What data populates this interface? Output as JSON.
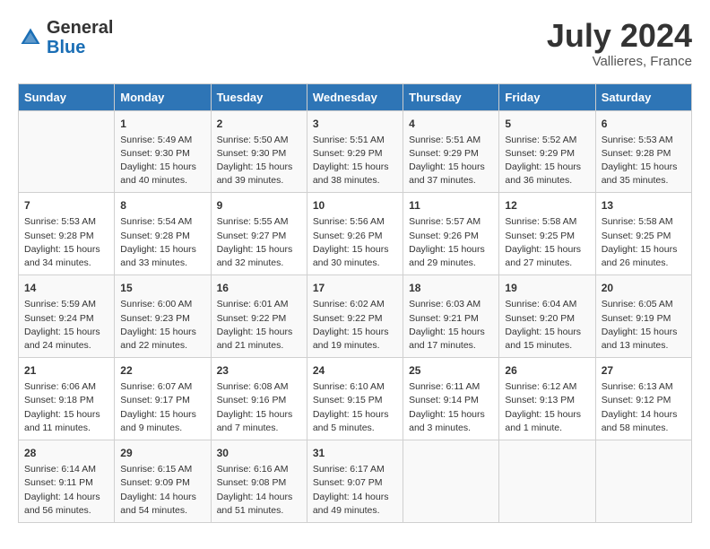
{
  "header": {
    "logo_general": "General",
    "logo_blue": "Blue",
    "month": "July 2024",
    "location": "Vallieres, France"
  },
  "columns": [
    "Sunday",
    "Monday",
    "Tuesday",
    "Wednesday",
    "Thursday",
    "Friday",
    "Saturday"
  ],
  "weeks": [
    [
      {
        "day": "",
        "info": ""
      },
      {
        "day": "1",
        "info": "Sunrise: 5:49 AM\nSunset: 9:30 PM\nDaylight: 15 hours\nand 40 minutes."
      },
      {
        "day": "2",
        "info": "Sunrise: 5:50 AM\nSunset: 9:30 PM\nDaylight: 15 hours\nand 39 minutes."
      },
      {
        "day": "3",
        "info": "Sunrise: 5:51 AM\nSunset: 9:29 PM\nDaylight: 15 hours\nand 38 minutes."
      },
      {
        "day": "4",
        "info": "Sunrise: 5:51 AM\nSunset: 9:29 PM\nDaylight: 15 hours\nand 37 minutes."
      },
      {
        "day": "5",
        "info": "Sunrise: 5:52 AM\nSunset: 9:29 PM\nDaylight: 15 hours\nand 36 minutes."
      },
      {
        "day": "6",
        "info": "Sunrise: 5:53 AM\nSunset: 9:28 PM\nDaylight: 15 hours\nand 35 minutes."
      }
    ],
    [
      {
        "day": "7",
        "info": "Sunrise: 5:53 AM\nSunset: 9:28 PM\nDaylight: 15 hours\nand 34 minutes."
      },
      {
        "day": "8",
        "info": "Sunrise: 5:54 AM\nSunset: 9:28 PM\nDaylight: 15 hours\nand 33 minutes."
      },
      {
        "day": "9",
        "info": "Sunrise: 5:55 AM\nSunset: 9:27 PM\nDaylight: 15 hours\nand 32 minutes."
      },
      {
        "day": "10",
        "info": "Sunrise: 5:56 AM\nSunset: 9:26 PM\nDaylight: 15 hours\nand 30 minutes."
      },
      {
        "day": "11",
        "info": "Sunrise: 5:57 AM\nSunset: 9:26 PM\nDaylight: 15 hours\nand 29 minutes."
      },
      {
        "day": "12",
        "info": "Sunrise: 5:58 AM\nSunset: 9:25 PM\nDaylight: 15 hours\nand 27 minutes."
      },
      {
        "day": "13",
        "info": "Sunrise: 5:58 AM\nSunset: 9:25 PM\nDaylight: 15 hours\nand 26 minutes."
      }
    ],
    [
      {
        "day": "14",
        "info": "Sunrise: 5:59 AM\nSunset: 9:24 PM\nDaylight: 15 hours\nand 24 minutes."
      },
      {
        "day": "15",
        "info": "Sunrise: 6:00 AM\nSunset: 9:23 PM\nDaylight: 15 hours\nand 22 minutes."
      },
      {
        "day": "16",
        "info": "Sunrise: 6:01 AM\nSunset: 9:22 PM\nDaylight: 15 hours\nand 21 minutes."
      },
      {
        "day": "17",
        "info": "Sunrise: 6:02 AM\nSunset: 9:22 PM\nDaylight: 15 hours\nand 19 minutes."
      },
      {
        "day": "18",
        "info": "Sunrise: 6:03 AM\nSunset: 9:21 PM\nDaylight: 15 hours\nand 17 minutes."
      },
      {
        "day": "19",
        "info": "Sunrise: 6:04 AM\nSunset: 9:20 PM\nDaylight: 15 hours\nand 15 minutes."
      },
      {
        "day": "20",
        "info": "Sunrise: 6:05 AM\nSunset: 9:19 PM\nDaylight: 15 hours\nand 13 minutes."
      }
    ],
    [
      {
        "day": "21",
        "info": "Sunrise: 6:06 AM\nSunset: 9:18 PM\nDaylight: 15 hours\nand 11 minutes."
      },
      {
        "day": "22",
        "info": "Sunrise: 6:07 AM\nSunset: 9:17 PM\nDaylight: 15 hours\nand 9 minutes."
      },
      {
        "day": "23",
        "info": "Sunrise: 6:08 AM\nSunset: 9:16 PM\nDaylight: 15 hours\nand 7 minutes."
      },
      {
        "day": "24",
        "info": "Sunrise: 6:10 AM\nSunset: 9:15 PM\nDaylight: 15 hours\nand 5 minutes."
      },
      {
        "day": "25",
        "info": "Sunrise: 6:11 AM\nSunset: 9:14 PM\nDaylight: 15 hours\nand 3 minutes."
      },
      {
        "day": "26",
        "info": "Sunrise: 6:12 AM\nSunset: 9:13 PM\nDaylight: 15 hours\nand 1 minute."
      },
      {
        "day": "27",
        "info": "Sunrise: 6:13 AM\nSunset: 9:12 PM\nDaylight: 14 hours\nand 58 minutes."
      }
    ],
    [
      {
        "day": "28",
        "info": "Sunrise: 6:14 AM\nSunset: 9:11 PM\nDaylight: 14 hours\nand 56 minutes."
      },
      {
        "day": "29",
        "info": "Sunrise: 6:15 AM\nSunset: 9:09 PM\nDaylight: 14 hours\nand 54 minutes."
      },
      {
        "day": "30",
        "info": "Sunrise: 6:16 AM\nSunset: 9:08 PM\nDaylight: 14 hours\nand 51 minutes."
      },
      {
        "day": "31",
        "info": "Sunrise: 6:17 AM\nSunset: 9:07 PM\nDaylight: 14 hours\nand 49 minutes."
      },
      {
        "day": "",
        "info": ""
      },
      {
        "day": "",
        "info": ""
      },
      {
        "day": "",
        "info": ""
      }
    ]
  ]
}
